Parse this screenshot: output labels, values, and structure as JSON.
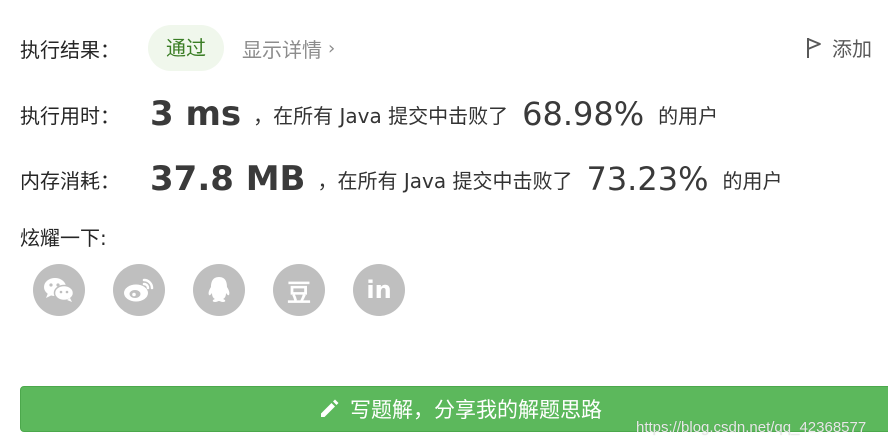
{
  "result": {
    "label": "执行结果：",
    "status": "通过",
    "details_link": "显示详情",
    "add_note": "添加"
  },
  "runtime": {
    "label": "执行用时：",
    "value": "3 ms",
    "middle_text": "，在所有 Java 提交中击败了",
    "percent": "68.98%",
    "suffix": "的用户"
  },
  "memory": {
    "label": "内存消耗：",
    "value": "37.8 MB",
    "middle_text": "，在所有 Java 提交中击败了",
    "percent": "73.23%",
    "suffix": "的用户"
  },
  "share": {
    "label": "炫耀一下:",
    "icons": [
      "wechat-icon",
      "weibo-icon",
      "qq-icon",
      "douban-icon",
      "linkedin-icon"
    ],
    "douban_glyph": "豆",
    "linkedin_glyph": "in"
  },
  "solution_button": {
    "label": "写题解，分享我的解题思路"
  },
  "watermark": "https://blog.csdn.net/qq_42368577",
  "colors": {
    "pass_bg": "#f0f7ec",
    "pass_text": "#3a7d24",
    "button_bg": "#5cb85c",
    "icon_bg": "#bfbfbf"
  }
}
